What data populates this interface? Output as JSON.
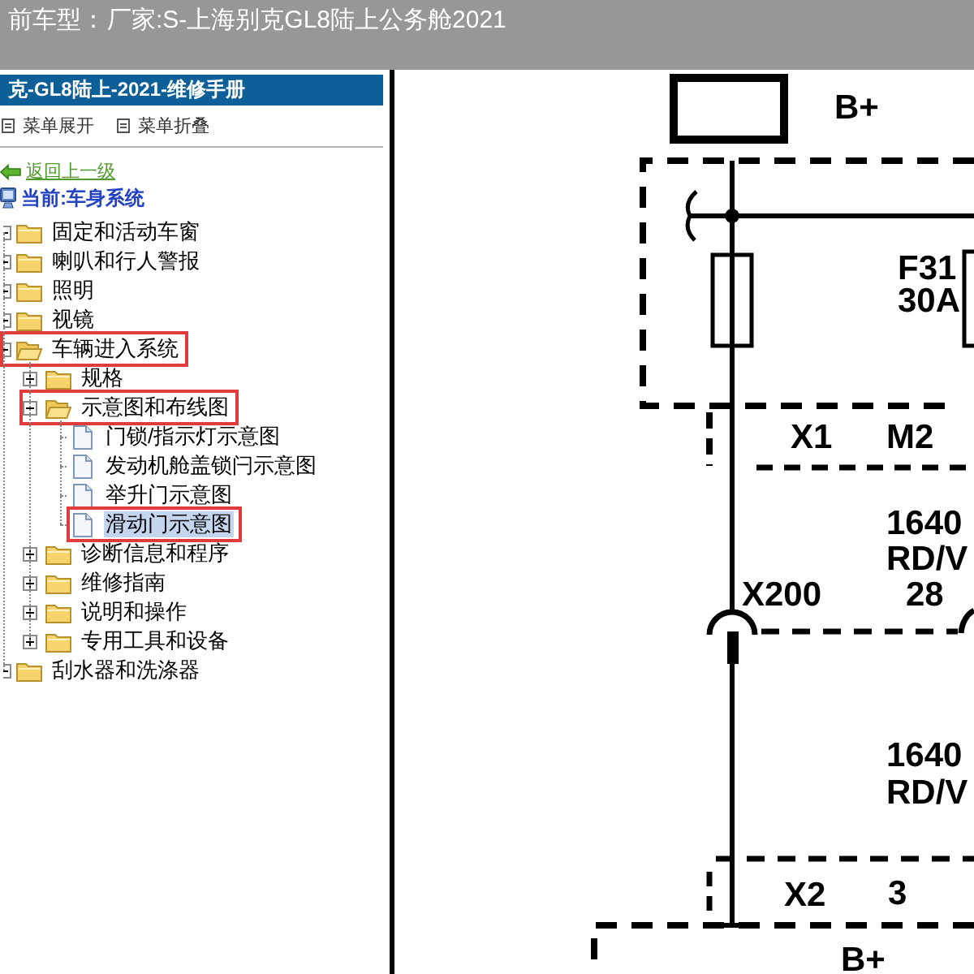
{
  "header": {
    "label": "前车型：",
    "vehicle": "厂家:S-上海别克GL8陆上公务舱2021"
  },
  "manual_panel": {
    "title": "克-GL8陆上-2021-维修手册",
    "toolbar": [
      {
        "label": "菜单展开"
      },
      {
        "label": "菜单折叠"
      }
    ],
    "back_link": "返回上一级",
    "current": "当前:车身系统",
    "tree": [
      {
        "kind": "folder",
        "label": "固定和活动车窗",
        "expanded": false,
        "selected": false,
        "outlined": false
      },
      {
        "kind": "folder",
        "label": "喇叭和行人警报",
        "expanded": false,
        "selected": false,
        "outlined": false
      },
      {
        "kind": "folder",
        "label": "照明",
        "expanded": false,
        "selected": false,
        "outlined": false
      },
      {
        "kind": "folder",
        "label": "视镜",
        "expanded": false,
        "selected": false,
        "outlined": false
      },
      {
        "kind": "folder",
        "label": "车辆进入系统",
        "expanded": true,
        "selected": false,
        "outlined": true,
        "children": [
          {
            "kind": "folder",
            "label": "规格",
            "expanded": false,
            "selected": false,
            "outlined": false
          },
          {
            "kind": "folder",
            "label": "示意图和布线图",
            "expanded": true,
            "selected": false,
            "outlined": true,
            "children": [
              {
                "kind": "document",
                "label": "门锁/指示灯示意图",
                "selected": false,
                "outlined": false
              },
              {
                "kind": "document",
                "label": "发动机舱盖锁闩示意图",
                "selected": false,
                "outlined": false
              },
              {
                "kind": "document",
                "label": "举升门示意图",
                "selected": false,
                "outlined": false
              },
              {
                "kind": "document",
                "label": "滑动门示意图",
                "selected": true,
                "outlined": true
              }
            ]
          },
          {
            "kind": "folder",
            "label": "诊断信息和程序",
            "expanded": false,
            "selected": false,
            "outlined": false
          },
          {
            "kind": "folder",
            "label": "维修指南",
            "expanded": false,
            "selected": false,
            "outlined": false
          },
          {
            "kind": "folder",
            "label": "说明和操作",
            "expanded": false,
            "selected": false,
            "outlined": false
          },
          {
            "kind": "folder",
            "label": "专用工具和设备",
            "expanded": false,
            "selected": false,
            "outlined": false
          }
        ]
      },
      {
        "kind": "folder",
        "label": "刮水器和洗涤器",
        "expanded": false,
        "selected": false,
        "outlined": false
      }
    ]
  },
  "diagram": {
    "top_connector": {
      "label": "B+"
    },
    "fuse": {
      "name": "F31",
      "rating": "30A"
    },
    "connector_x1": {
      "name": "X1",
      "pin": "M2"
    },
    "wire_upper": {
      "circuit": "1640",
      "wire_color": "RD/V"
    },
    "inline_connector": {
      "name": "X200",
      "pin": "28"
    },
    "wire_lower": {
      "circuit": "1640",
      "wire_color": "RD/V"
    },
    "connector_x2": {
      "name": "X2",
      "pin": "3"
    },
    "bottom_module": {
      "label": "B+"
    }
  }
}
